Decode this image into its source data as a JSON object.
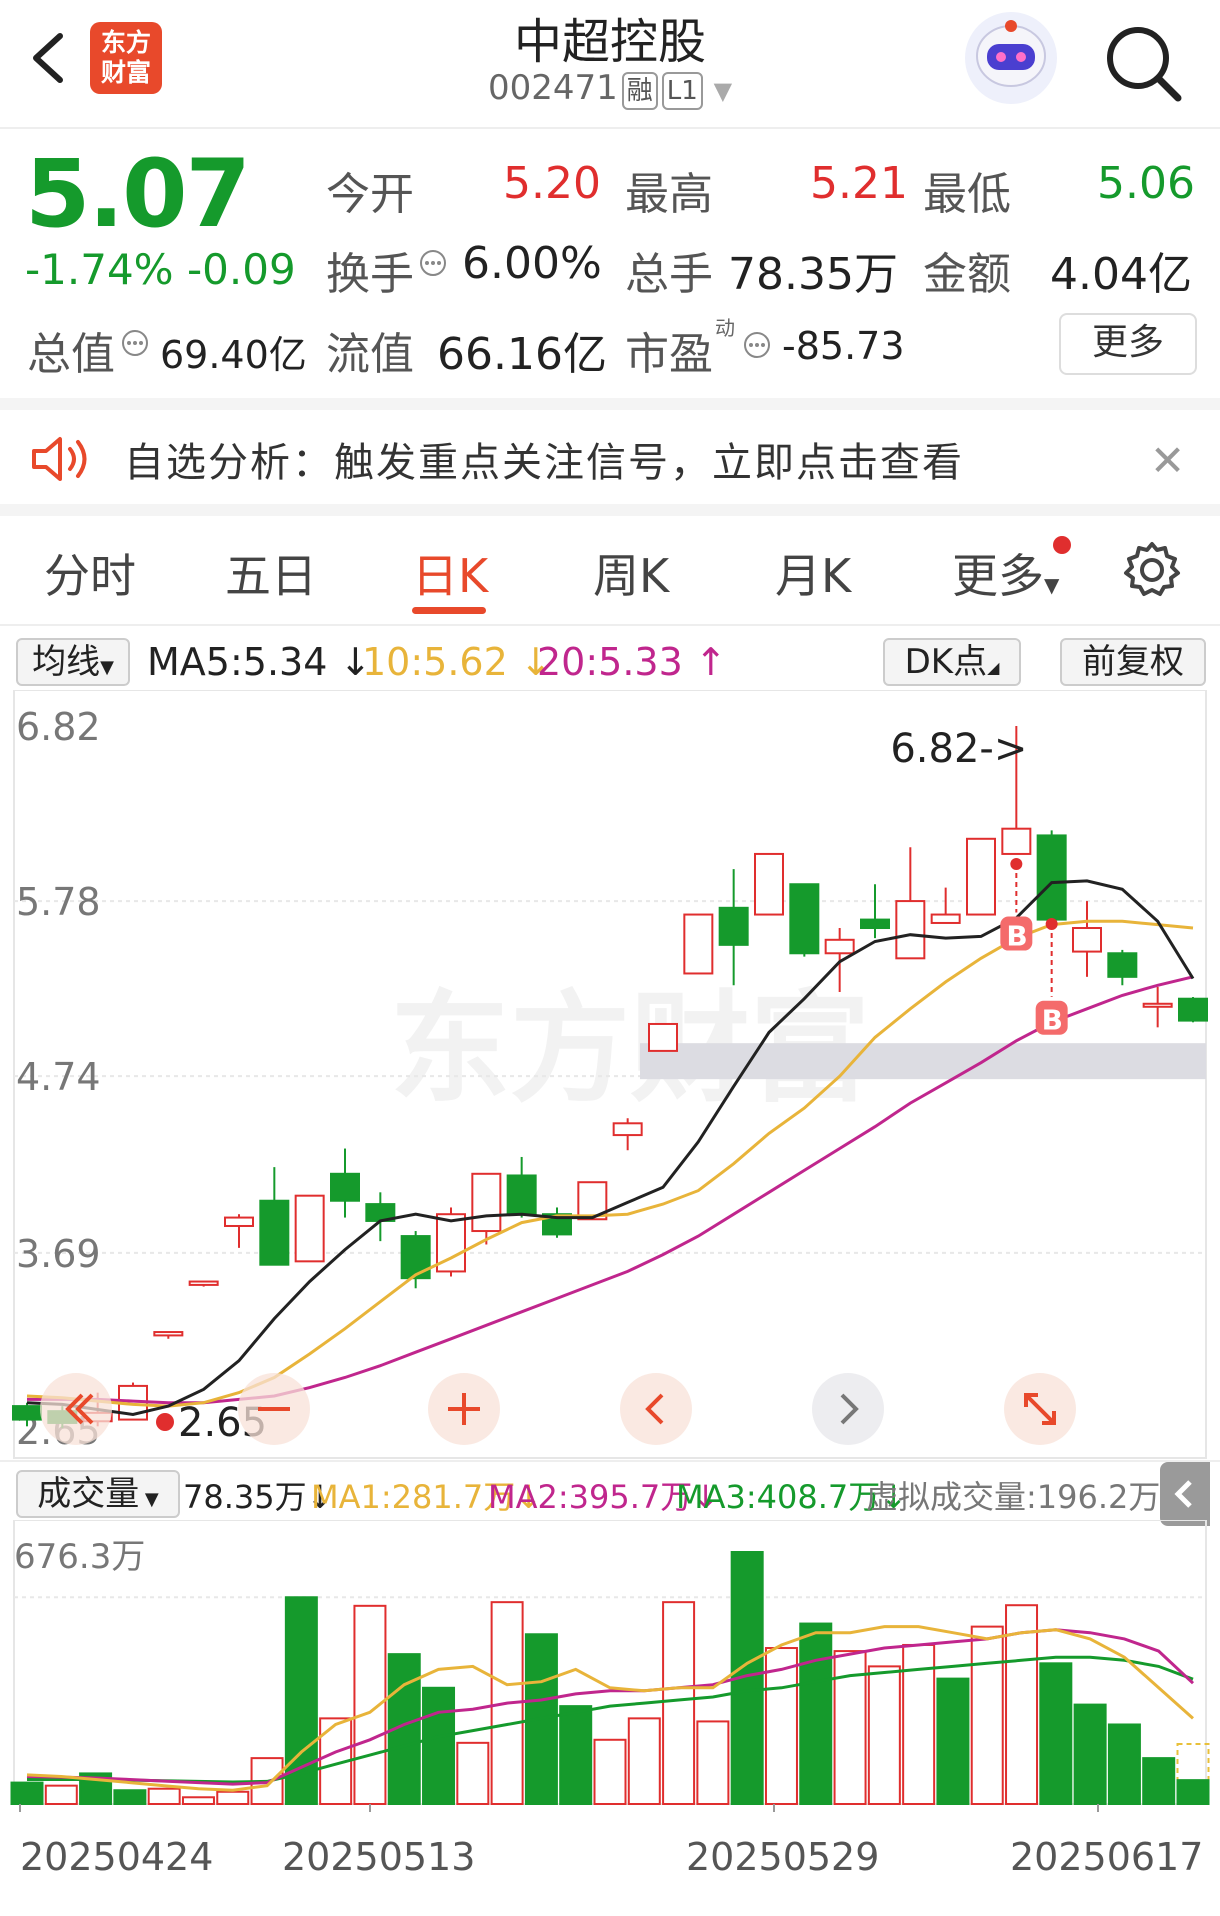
{
  "header": {
    "title": "中超控股",
    "code": "002471",
    "tag_margin": "融",
    "tag_level": "L1",
    "logo_text_1": "东方",
    "logo_text_2": "财富"
  },
  "quote": {
    "price": "5.07",
    "change_pct": "-1.74%",
    "change_abs": "-0.09",
    "open_label": "今开",
    "open_value": "5.20",
    "high_label": "最高",
    "high_value": "5.21",
    "low_label": "最低",
    "low_value": "5.06",
    "turnover_label": "换手",
    "turnover_value": "6.00%",
    "volume_label": "总手",
    "volume_value": "78.35万",
    "amount_label": "金额",
    "amount_value": "4.04亿",
    "mktcap_label": "总值",
    "mktcap_value": "69.40亿",
    "float_label": "流值",
    "float_value": "66.16亿",
    "pe_label": "市盈",
    "pe_sup": "动",
    "pe_value": "-85.73",
    "more_label": "更多"
  },
  "notice": {
    "text": "自选分析：触发重点关注信号，立即点击查看"
  },
  "tabs": [
    {
      "label": "分时"
    },
    {
      "label": "五日"
    },
    {
      "label": "日K"
    },
    {
      "label": "周K"
    },
    {
      "label": "月K"
    },
    {
      "label": "更多"
    }
  ],
  "ma_bar": {
    "selector": "均线",
    "ma5": "MA5:5.34",
    "ma10": "10:5.62",
    "ma20": "20:5.33",
    "dk_label": "DK点",
    "adjust_label": "前复权"
  },
  "colors": {
    "up": "#e02e2e",
    "down": "#159a2c",
    "ma5": "#222222",
    "ma10": "#e8b43a",
    "ma20": "#c0268d",
    "accent": "#e8492b"
  },
  "chart_data": {
    "type": "candlestick",
    "y_ticks": [
      "6.82",
      "5.78",
      "4.74",
      "3.69",
      "2.65"
    ],
    "ylim": [
      2.65,
      6.82
    ],
    "max_label": "6.82->",
    "min_label": "2.65",
    "buy_marker": "B",
    "watermark": "东方财富",
    "x_labels": [
      "20250424",
      "20250513",
      "20250529",
      "20250617"
    ],
    "candles": [
      {
        "o": 2.78,
        "c": 2.7,
        "h": 2.8,
        "l": 2.66
      },
      {
        "o": 2.75,
        "c": 2.68,
        "h": 2.78,
        "l": 2.65
      },
      {
        "o": 2.69,
        "c": 2.74,
        "h": 2.86,
        "l": 2.66
      },
      {
        "o": 2.7,
        "c": 2.9,
        "h": 2.92,
        "l": 2.7
      },
      {
        "o": 3.2,
        "c": 3.22,
        "h": 3.22,
        "l": 3.18
      },
      {
        "o": 3.5,
        "c": 3.52,
        "h": 3.52,
        "l": 3.49
      },
      {
        "o": 3.85,
        "c": 3.9,
        "h": 3.92,
        "l": 3.72
      },
      {
        "o": 4.0,
        "c": 3.62,
        "h": 4.2,
        "l": 3.62
      },
      {
        "o": 3.64,
        "c": 4.03,
        "h": 4.03,
        "l": 3.64
      },
      {
        "o": 4.16,
        "c": 4.0,
        "h": 4.31,
        "l": 3.9
      },
      {
        "o": 3.98,
        "c": 3.88,
        "h": 4.05,
        "l": 3.76
      },
      {
        "o": 3.79,
        "c": 3.54,
        "h": 3.82,
        "l": 3.48
      },
      {
        "o": 3.58,
        "c": 3.92,
        "h": 3.96,
        "l": 3.55
      },
      {
        "o": 3.82,
        "c": 4.16,
        "h": 4.16,
        "l": 3.74
      },
      {
        "o": 4.15,
        "c": 3.92,
        "h": 4.26,
        "l": 3.9
      },
      {
        "o": 3.92,
        "c": 3.8,
        "h": 3.96,
        "l": 3.78
      },
      {
        "o": 3.89,
        "c": 4.11,
        "h": 4.11,
        "l": 3.89
      },
      {
        "o": 4.39,
        "c": 4.46,
        "h": 4.49,
        "l": 4.3
      },
      {
        "o": 4.89,
        "c": 5.05,
        "h": 5.05,
        "l": 4.89
      },
      {
        "o": 5.35,
        "c": 5.7,
        "h": 5.7,
        "l": 5.35
      },
      {
        "o": 5.74,
        "c": 5.52,
        "h": 5.97,
        "l": 5.28
      },
      {
        "o": 5.7,
        "c": 6.06,
        "h": 6.06,
        "l": 5.7
      },
      {
        "o": 5.88,
        "c": 5.47,
        "h": 5.88,
        "l": 5.45
      },
      {
        "o": 5.47,
        "c": 5.55,
        "h": 5.62,
        "l": 5.24
      },
      {
        "o": 5.67,
        "c": 5.62,
        "h": 5.88,
        "l": 5.56
      },
      {
        "o": 5.44,
        "c": 5.78,
        "h": 6.1,
        "l": 5.44
      },
      {
        "o": 5.65,
        "c": 5.7,
        "h": 5.86,
        "l": 5.65
      },
      {
        "o": 5.7,
        "c": 6.15,
        "h": 6.15,
        "l": 5.7
      },
      {
        "o": 6.06,
        "c": 6.21,
        "h": 6.82,
        "l": 6.06
      },
      {
        "o": 6.17,
        "c": 5.67,
        "h": 6.2,
        "l": 5.67
      },
      {
        "o": 5.48,
        "c": 5.62,
        "h": 5.78,
        "l": 5.33
      },
      {
        "o": 5.47,
        "c": 5.33,
        "h": 5.49,
        "l": 5.28
      },
      {
        "o": 5.17,
        "c": 5.17,
        "h": 5.27,
        "l": 5.03
      },
      {
        "o": 5.2,
        "c": 5.07,
        "h": 5.21,
        "l": 5.06
      }
    ],
    "ma5": [
      2.8,
      2.79,
      2.76,
      2.73,
      2.78,
      2.88,
      3.05,
      3.3,
      3.52,
      3.71,
      3.88,
      3.92,
      3.88,
      3.91,
      3.92,
      3.9,
      3.9,
      3.99,
      4.08,
      4.35,
      4.68,
      5.0,
      5.2,
      5.42,
      5.54,
      5.58,
      5.56,
      5.57,
      5.68,
      5.89,
      5.9,
      5.85,
      5.66,
      5.32
    ],
    "ma10": [
      2.84,
      2.83,
      2.81,
      2.79,
      2.78,
      2.8,
      2.86,
      2.95,
      3.09,
      3.24,
      3.4,
      3.56,
      3.66,
      3.77,
      3.87,
      3.91,
      3.91,
      3.92,
      3.98,
      4.06,
      4.22,
      4.4,
      4.55,
      4.74,
      4.97,
      5.14,
      5.3,
      5.44,
      5.56,
      5.64,
      5.66,
      5.66,
      5.64,
      5.62
    ],
    "ma20": [
      2.82,
      2.82,
      2.82,
      2.81,
      2.8,
      2.8,
      2.82,
      2.84,
      2.89,
      2.95,
      3.02,
      3.1,
      3.18,
      3.26,
      3.34,
      3.42,
      3.5,
      3.58,
      3.68,
      3.79,
      3.92,
      4.05,
      4.18,
      4.31,
      4.44,
      4.58,
      4.7,
      4.82,
      4.95,
      5.06,
      5.14,
      5.22,
      5.28,
      5.33
    ]
  },
  "volume": {
    "selector": "成交量",
    "value": "78.35万",
    "ma1": "MA1:281.7万",
    "ma2": "MA2:395.7万",
    "ma3": "MA3:408.7万",
    "virtual": "虚拟成交量:196.2万",
    "max_label": "676.3万",
    "bars": [
      {
        "v": 70,
        "up": false
      },
      {
        "v": 60,
        "up": true
      },
      {
        "v": 100,
        "up": false
      },
      {
        "v": 45,
        "up": false
      },
      {
        "v": 50,
        "up": true
      },
      {
        "v": 22,
        "up": true
      },
      {
        "v": 40,
        "up": true
      },
      {
        "v": 150,
        "up": true
      },
      {
        "v": 676,
        "up": false
      },
      {
        "v": 280,
        "up": true
      },
      {
        "v": 648,
        "up": true
      },
      {
        "v": 490,
        "up": false
      },
      {
        "v": 380,
        "up": false
      },
      {
        "v": 200,
        "up": true
      },
      {
        "v": 660,
        "up": true
      },
      {
        "v": 555,
        "up": false
      },
      {
        "v": 320,
        "up": false
      },
      {
        "v": 210,
        "up": true
      },
      {
        "v": 280,
        "up": true
      },
      {
        "v": 660,
        "up": true
      },
      {
        "v": 270,
        "up": true
      },
      {
        "v": 824,
        "up": false
      },
      {
        "v": 510,
        "up": true
      },
      {
        "v": 590,
        "up": false
      },
      {
        "v": 500,
        "up": true
      },
      {
        "v": 450,
        "up": true
      },
      {
        "v": 520,
        "up": true
      },
      {
        "v": 410,
        "up": false
      },
      {
        "v": 580,
        "up": true
      },
      {
        "v": 650,
        "up": true
      },
      {
        "v": 460,
        "up": false
      },
      {
        "v": 325,
        "up": false
      },
      {
        "v": 260,
        "up": false
      },
      {
        "v": 150,
        "up": false
      },
      {
        "v": 78,
        "up": false
      }
    ],
    "ma1_line": [
      95,
      90,
      80,
      70,
      60,
      50,
      45,
      60,
      170,
      260,
      300,
      390,
      440,
      450,
      390,
      400,
      440,
      380,
      370,
      380,
      380,
      460,
      520,
      560,
      560,
      580,
      580,
      560,
      540,
      560,
      570,
      540,
      480,
      380,
      280
    ],
    "ma2_line": [
      90,
      88,
      85,
      80,
      75,
      70,
      65,
      70,
      120,
      170,
      210,
      260,
      300,
      310,
      330,
      340,
      360,
      370,
      370,
      380,
      390,
      420,
      440,
      470,
      490,
      510,
      520,
      530,
      540,
      560,
      570,
      560,
      540,
      500,
      395
    ],
    "ma3_line": [
      80,
      80,
      80,
      78,
      76,
      74,
      72,
      74,
      100,
      130,
      160,
      190,
      220,
      240,
      260,
      280,
      300,
      320,
      330,
      340,
      350,
      370,
      380,
      400,
      420,
      430,
      440,
      450,
      460,
      470,
      480,
      480,
      470,
      450,
      408
    ]
  }
}
